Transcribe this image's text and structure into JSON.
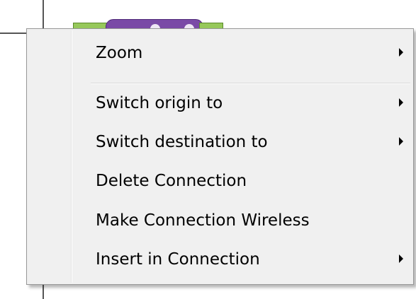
{
  "context_menu": {
    "items": [
      {
        "label": "Zoom",
        "has_submenu": true
      },
      {
        "label": "Switch origin to",
        "has_submenu": true
      },
      {
        "label": "Switch destination to",
        "has_submenu": true
      },
      {
        "label": "Delete Connection",
        "has_submenu": false
      },
      {
        "label": "Make Connection Wireless",
        "has_submenu": false
      },
      {
        "label": "Insert in Connection",
        "has_submenu": true
      }
    ],
    "submenu_arrow_icon": "chevron-right-icon"
  },
  "colors": {
    "menu_background": "#f0f0f0",
    "menu_border": "#979797",
    "node_purple": "#7a4aa6",
    "node_green": "#96c85a"
  }
}
